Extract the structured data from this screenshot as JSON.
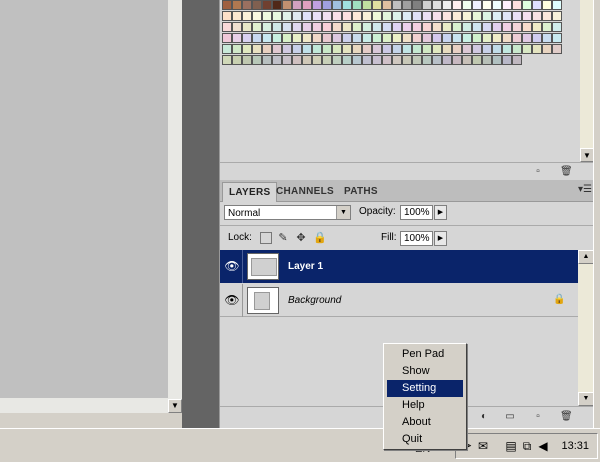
{
  "layers_panel": {
    "tabs": [
      "LAYERS",
      "CHANNELS",
      "PATHS"
    ],
    "active_tab": "LAYERS",
    "blend_mode": "Normal",
    "opacity_label": "Opacity:",
    "opacity_value": "100%",
    "lock_label": "Lock:",
    "fill_label": "Fill:",
    "fill_value": "100%",
    "layers": [
      {
        "name": "Layer 1",
        "selected": true,
        "visible": true,
        "locked": false
      },
      {
        "name": "Background",
        "selected": false,
        "visible": true,
        "locked": true
      }
    ]
  },
  "context_menu": {
    "items": [
      "Pen Pad",
      "Show",
      "Setting",
      "Help",
      "About",
      "Quit"
    ],
    "highlighted": "Setting"
  },
  "taskbar": {
    "language": "EN",
    "clock": "13:31"
  },
  "colors": {
    "selection": "#0a246a",
    "panel_bg": "#d6d6d6",
    "workspace_gutter": "#646464"
  },
  "icons": [
    "eye-icon",
    "lock-transparent-icon",
    "brush-icon",
    "move-icon",
    "lock-icon",
    "new-layer-icon",
    "trash-icon",
    "adjustment-icon",
    "folder-icon",
    "envelope-icon",
    "network-icon",
    "speaker-icon"
  ]
}
